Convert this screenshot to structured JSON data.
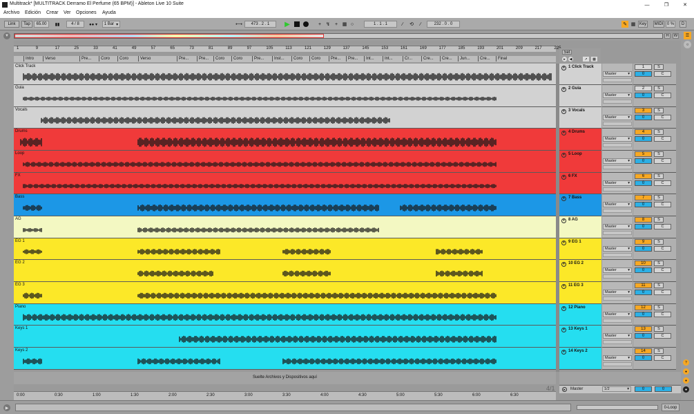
{
  "titlebar": {
    "title": "Multitrack*  [MULTITRACK Derramo El Perfume (65 BPM)] - Ableton Live 10 Suite"
  },
  "menu": [
    "Archivo",
    "Edición",
    "Crear",
    "Ver",
    "Opciones",
    "Ayuda"
  ],
  "transport": {
    "link": "Link",
    "tap": "Tap",
    "tempo": "65.00",
    "signature": "4 / 8",
    "metronome": "1 Bar",
    "position": "473 .  2 .  1",
    "loop_start": "1 .   1 .   1",
    "loop_length": "232 .   0 .   0",
    "key": "Key",
    "midi": "MIDI",
    "cpu": "0 %",
    "d": "D"
  },
  "overview": {
    "h": "H",
    "w": "W"
  },
  "ruler": [
    "1",
    "9",
    "17",
    "25",
    "33",
    "41",
    "49",
    "57",
    "65",
    "73",
    "81",
    "89",
    "97",
    "105",
    "113",
    "121",
    "129",
    "137",
    "145",
    "153",
    "161",
    "169",
    "177",
    "185",
    "193",
    "201",
    "209",
    "217",
    "225"
  ],
  "markers": [
    "Intro",
    "Verso",
    "Pre...",
    "Coro",
    "Coro",
    "Verso",
    "Pre...",
    "Pre...",
    "Coro",
    "Coro",
    "Pre...",
    "Inst...",
    "Coro",
    "Coro",
    "Pre...",
    "Pre...",
    "Int...",
    "Int...",
    "Cr...",
    "Cre...",
    "Cre...",
    "Jun...",
    "Cre...",
    "Final"
  ],
  "set_label": "Set",
  "tracks": [
    {
      "lane": "Click Track",
      "name": "1 Click Track",
      "color": "#d2d2d2",
      "num": "1",
      "num_color": "#d8d8d8",
      "vol": "0",
      "out": "Master"
    },
    {
      "lane": "Guia",
      "name": "2 Guia",
      "color": "#d2d2d2",
      "num": "2",
      "num_color": "#d8d8d8",
      "vol": "0",
      "out": "Master"
    },
    {
      "lane": "Vocals",
      "name": "3 Vocals",
      "color": "#d2d2d2",
      "num": "3",
      "num_color": "#f7a823",
      "vol": "0",
      "out": "Master"
    },
    {
      "lane": "Drums",
      "name": "4 Drums",
      "color": "#f03a3a",
      "num": "4",
      "num_color": "#f7a823",
      "vol": "0",
      "out": "Master"
    },
    {
      "lane": "Loop",
      "name": "5 Loop",
      "color": "#f03a3a",
      "num": "5",
      "num_color": "#f7a823",
      "vol": "0",
      "out": "Master"
    },
    {
      "lane": "FX",
      "name": "6 FX",
      "color": "#f03a3a",
      "num": "6",
      "num_color": "#f7a823",
      "vol": "0",
      "out": "Master"
    },
    {
      "lane": "Bass",
      "name": "7 Bass",
      "color": "#1c97e6",
      "num": "7",
      "num_color": "#f7a823",
      "vol": "0",
      "out": "Master"
    },
    {
      "lane": "AG",
      "name": "8 AG",
      "color": "#f3f8c2",
      "num": "8",
      "num_color": "#f7a823",
      "vol": "0",
      "out": "Master"
    },
    {
      "lane": "EG 1",
      "name": "9 EG 1",
      "color": "#fce828",
      "num": "9",
      "num_color": "#f7a823",
      "vol": "0",
      "out": "Master"
    },
    {
      "lane": "EG 2",
      "name": "10 EG 2",
      "color": "#fce828",
      "num": "10",
      "num_color": "#f7a823",
      "vol": "0",
      "out": "Master"
    },
    {
      "lane": "EG 3",
      "name": "11 EG 3",
      "color": "#fce828",
      "num": "11",
      "num_color": "#f7a823",
      "vol": "0",
      "out": "Master"
    },
    {
      "lane": "Piano",
      "name": "12 Piano",
      "color": "#25def0",
      "num": "12",
      "num_color": "#f7a823",
      "vol": "0",
      "out": "Master"
    },
    {
      "lane": "Keys 1",
      "name": "13 Keys 1",
      "color": "#25def0",
      "num": "13",
      "num_color": "#f7a823",
      "vol": "0",
      "out": "Master"
    },
    {
      "lane": "Keys 2",
      "name": "14 Keys 2",
      "color": "#25def0",
      "num": "14",
      "num_color": "#f7a823",
      "vol": "0",
      "out": "Master"
    }
  ],
  "mixer": {
    "solo": "S",
    "cue": "C"
  },
  "drop_hint": "Suelte Archivos y Dispositivos aquí",
  "grid_label": "4/1",
  "master": {
    "name": "Master",
    "out": "1/2",
    "vol": "0",
    "cue": "0"
  },
  "time_ruler": [
    "0:00",
    "0:30",
    "1:00",
    "1:30",
    "2:00",
    "2:30",
    "3:00",
    "3:30",
    "4:00",
    "4:30",
    "5:00",
    "5:30",
    "6:00",
    "6:30"
  ],
  "status": {
    "loop_button": "0-Loop"
  },
  "colors": {
    "accent": "#f7a823",
    "play": "#2ec82e",
    "volume": "#2cb0e6"
  }
}
